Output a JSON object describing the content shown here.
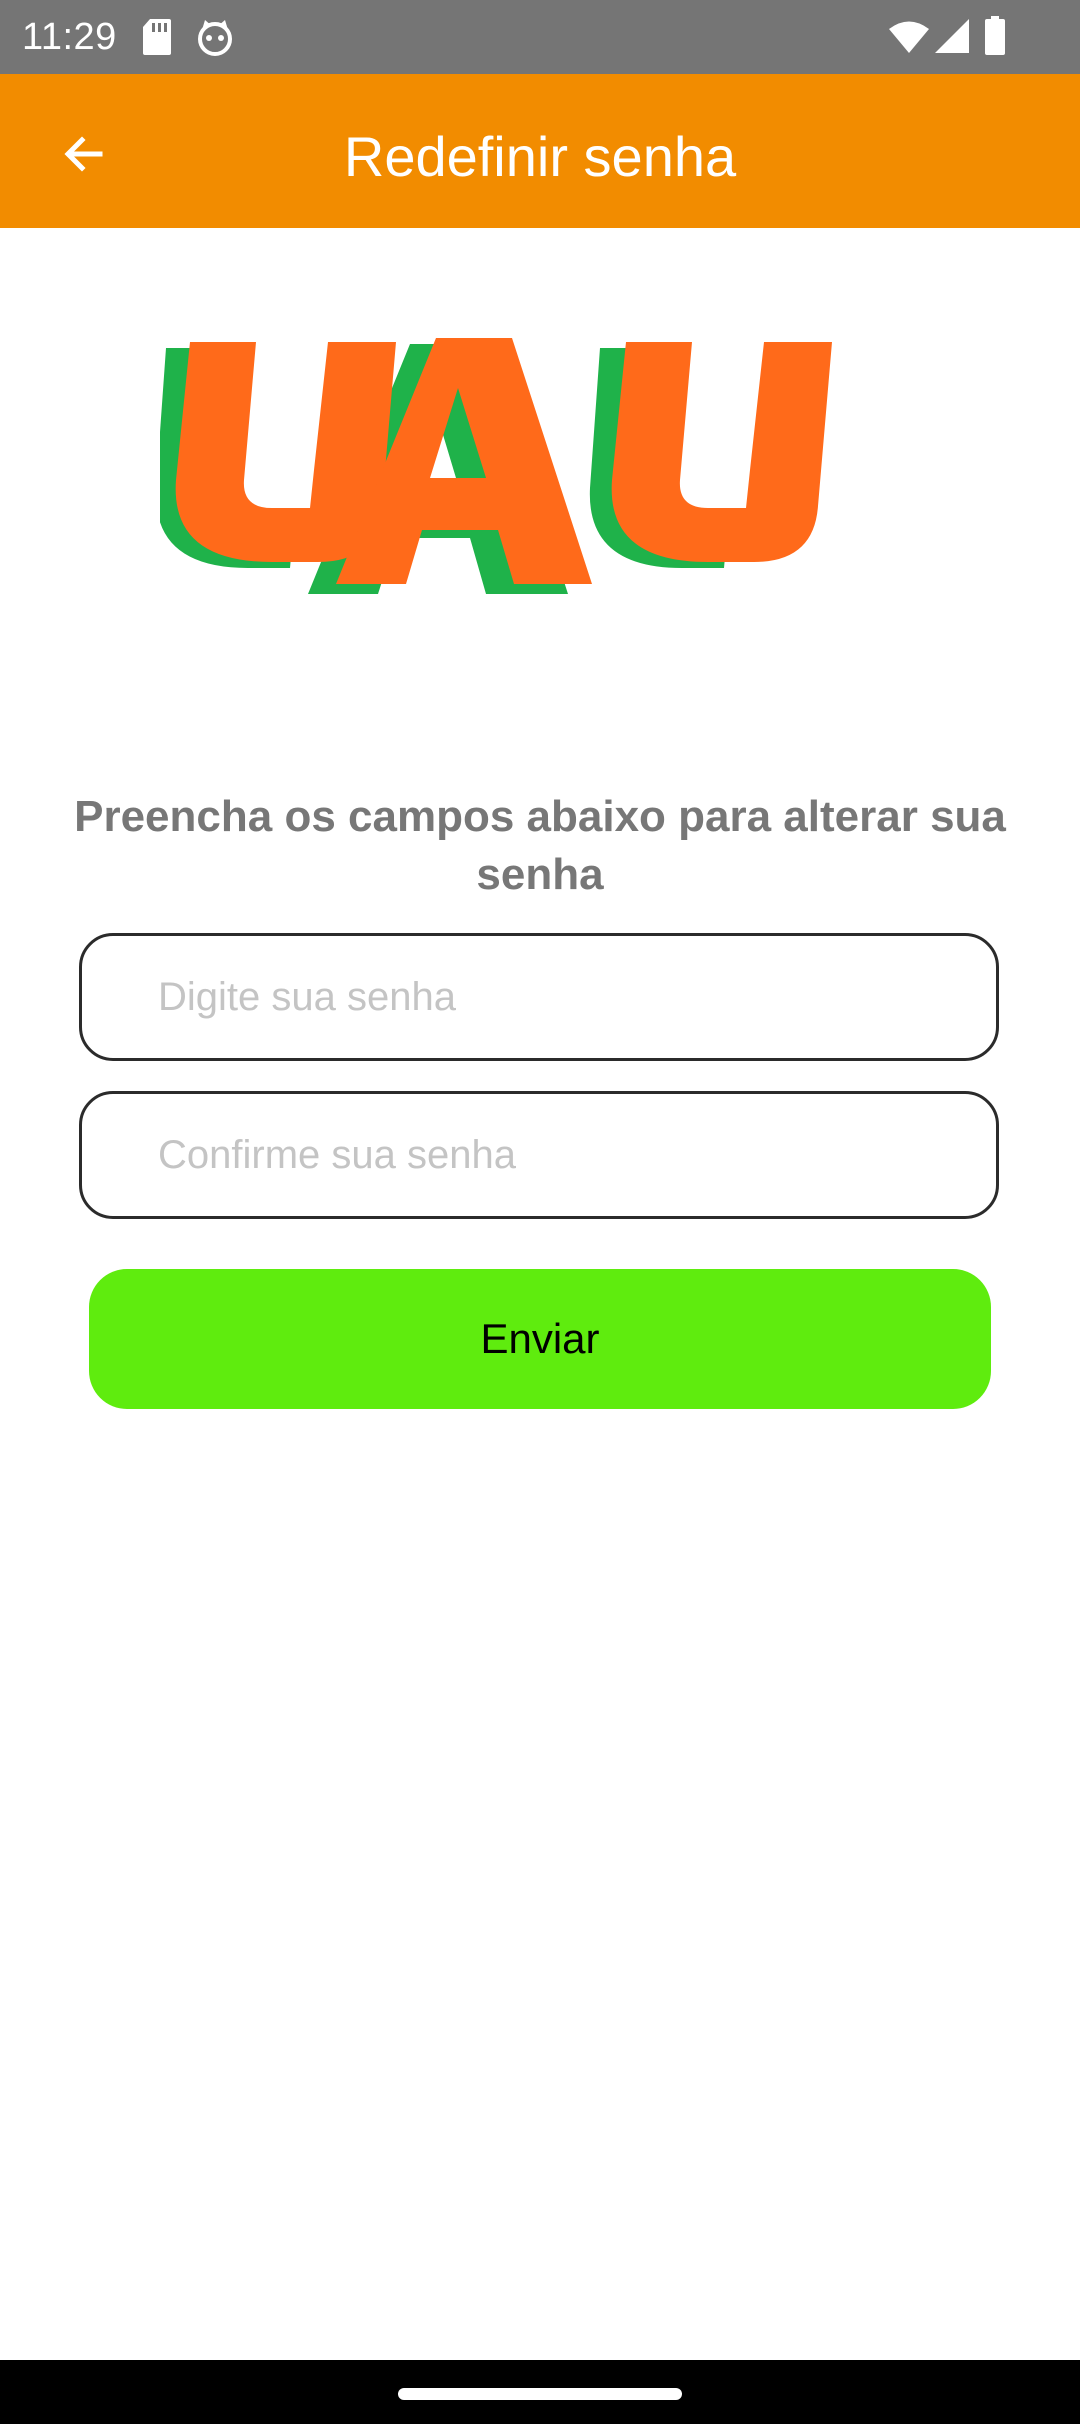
{
  "status_bar": {
    "time": "11:29",
    "icons": [
      "sd-card-icon",
      "cat-face-icon",
      "wifi-icon",
      "signal-icon",
      "battery-icon"
    ]
  },
  "app_bar": {
    "title": "Redefinir senha",
    "back_icon": "arrow-left-icon"
  },
  "logo": {
    "text": "UAU",
    "colors": {
      "front": "#ff6a1a",
      "shadow": "#1fb24a"
    }
  },
  "form": {
    "instructions": "Preencha os campos abaixo para alterar sua senha",
    "password": {
      "value": "",
      "placeholder": "Digite sua senha"
    },
    "confirm_password": {
      "value": "",
      "placeholder": "Confirme sua senha"
    },
    "submit_label": "Enviar"
  },
  "colors": {
    "accent": "#f28c00",
    "button": "#5fec0e",
    "status_bar": "#757575"
  }
}
